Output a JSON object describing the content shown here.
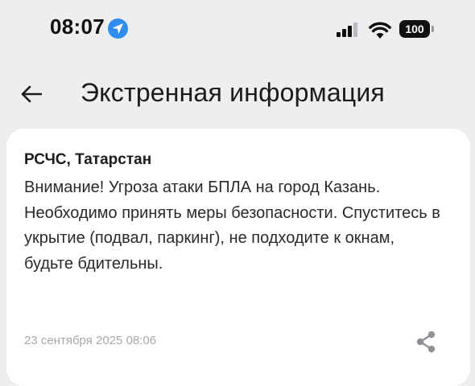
{
  "status_bar": {
    "time": "08:07",
    "battery": "100",
    "icons": [
      "location-arrow-icon",
      "cellular-signal-icon",
      "wifi-icon",
      "battery-icon"
    ]
  },
  "header": {
    "title": "Экстренная информация",
    "back_icon": "arrow-left-icon"
  },
  "alert": {
    "sender": "РСЧС, Татарстан",
    "message": "Внимание! Угроза атаки БПЛА на город Казань. Необходимо принять меры безопасности. Спуститесь в укрытие (подвал, паркинг), не подходите к окнам, будьте бдительны.",
    "timestamp": "23 сентября 2025 08:06",
    "share_icon": "share-icon"
  },
  "colors": {
    "background": "#eceef0",
    "card": "#ffffff",
    "location_accent": "#2f8cf0",
    "timestamp_text": "#a7a9ac",
    "share_icon": "#8e9297"
  }
}
